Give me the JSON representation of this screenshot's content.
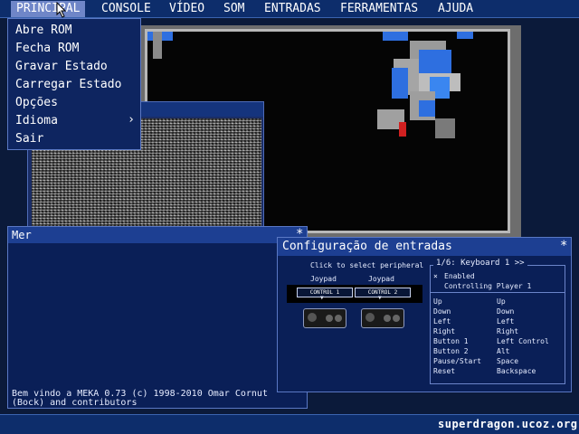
{
  "menubar": {
    "items": [
      {
        "label": "PRINCIPAL",
        "active": true
      },
      {
        "label": "CONSOLE"
      },
      {
        "label": "VÍDEO"
      },
      {
        "label": "SOM"
      },
      {
        "label": "ENTRADAS"
      },
      {
        "label": "FERRAMENTAS"
      },
      {
        "label": "AJUDA"
      }
    ]
  },
  "dropdown": {
    "items": [
      "Abre ROM",
      "Fecha ROM",
      "Gravar Estado",
      "Carregar Estado",
      "Opções",
      "Idioma",
      "Sair"
    ],
    "submenu_arrow": "›"
  },
  "message_window": {
    "title": "Mer",
    "close": "*",
    "text": "Bem vindo a MEKA 0.73 (c) 1998-2010 Omar Cornut\n(Bock) and contributors"
  },
  "input_window": {
    "title": "Configuração de entradas",
    "close": "*",
    "click_hint": "Click to select peripheral",
    "peripherals": [
      {
        "type": "Joypad",
        "control": "CONTROL 1",
        "arrow": "▼"
      },
      {
        "type": "Joypad",
        "control": "CONTROL 2",
        "arrow": "▼"
      }
    ],
    "keyboard_header": "1/6: Keyboard 1 >>",
    "enabled": "Enabled",
    "controlling": "Controlling Player 1",
    "checkbox": "×",
    "mappings": [
      {
        "action": "Up",
        "key": "Up"
      },
      {
        "action": "Down",
        "key": "Down"
      },
      {
        "action": "Left",
        "key": "Left"
      },
      {
        "action": "Right",
        "key": "Right"
      },
      {
        "action": "Button 1",
        "key": "Left Control"
      },
      {
        "action": "Button 2",
        "key": "Alt"
      },
      {
        "action": "Pause/Start",
        "key": "Space"
      },
      {
        "action": "Reset",
        "key": "Backspace"
      }
    ]
  },
  "watermark": "superdragon.ucoz.org",
  "colors": {
    "menubar": "#0d2d6b",
    "menu_active": "#6f86c8",
    "window_bg": "#0a1f57",
    "titlebar": "#1d3f92",
    "sprite_blue": "#2e6fe0"
  }
}
